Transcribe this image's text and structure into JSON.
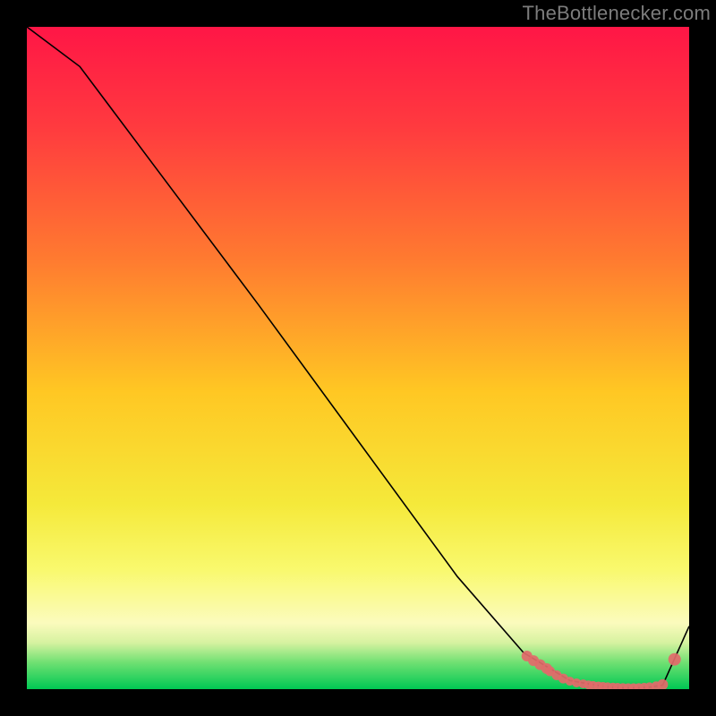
{
  "watermark": "TheBottlenecker.com",
  "colors": {
    "curve": "#000000",
    "marker": "#e26a6a",
    "gradient_top": "#ff1646",
    "gradient_bottom": "#00c853"
  },
  "chart_data": {
    "type": "line",
    "title": "",
    "xlabel": "",
    "ylabel": "",
    "xlim": [
      0,
      100
    ],
    "ylim": [
      0,
      100
    ],
    "x": [
      0,
      8,
      20,
      35,
      50,
      65,
      75,
      82,
      86,
      88,
      90,
      92,
      94,
      96,
      100
    ],
    "y": [
      100,
      94,
      78,
      58,
      37.5,
      17,
      5.5,
      1.3,
      0.6,
      0.3,
      0.2,
      0.2,
      0.3,
      0.6,
      9.5
    ],
    "markers": {
      "x": [
        75.5,
        76.5,
        77.5,
        78.5,
        79.0,
        80.0,
        81.0,
        82.0,
        83.0,
        84.0,
        84.8,
        85.5,
        86.3,
        87.0,
        87.7,
        88.5,
        89.2,
        90.0,
        90.8,
        91.6,
        92.4,
        93.2,
        94.0,
        95.0,
        96.0,
        97.8
      ],
      "y": [
        5.0,
        4.3,
        3.7,
        3.1,
        2.7,
        2.1,
        1.6,
        1.2,
        0.95,
        0.8,
        0.65,
        0.55,
        0.48,
        0.4,
        0.35,
        0.3,
        0.27,
        0.24,
        0.22,
        0.22,
        0.24,
        0.28,
        0.35,
        0.5,
        0.7,
        4.5
      ],
      "r": [
        6,
        6,
        6,
        6,
        5.5,
        5.5,
        5.5,
        5,
        5,
        5,
        5,
        5,
        5,
        5,
        5,
        5,
        5,
        5,
        5,
        5,
        5,
        5,
        5,
        5,
        6,
        7
      ]
    }
  }
}
